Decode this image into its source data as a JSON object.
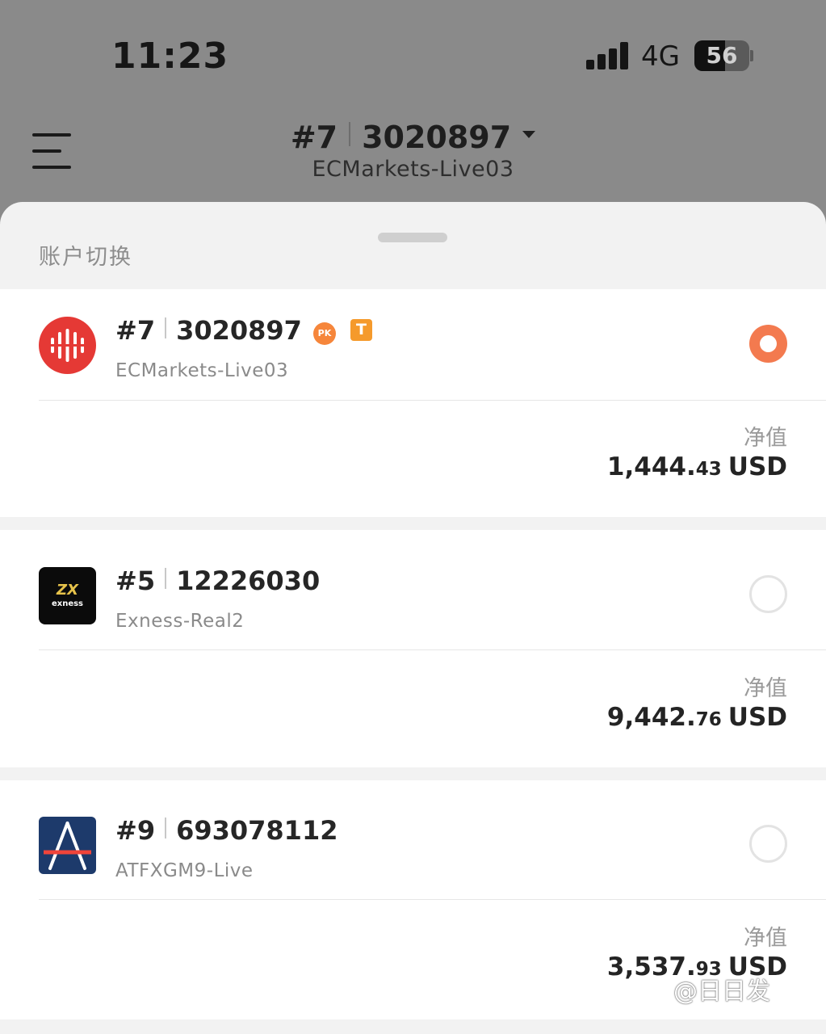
{
  "status_bar": {
    "time": "11:23",
    "network": "4G",
    "battery": "56"
  },
  "header": {
    "account_index": "#7",
    "account_number": "3020897",
    "server": "ECMarkets-Live03"
  },
  "sheet": {
    "title": "账户切换",
    "accounts": [
      {
        "index": "#7",
        "number": "3020897",
        "server": "ECMarkets-Live03",
        "selected": true,
        "badges": [
          "PK",
          "T"
        ],
        "equity_label": "净值",
        "equity_int": "1,444.",
        "equity_dec": "43",
        "currency": "USD",
        "logo": "ecmarkets-logo"
      },
      {
        "index": "#5",
        "number": "12226030",
        "server": "Exness-Real2",
        "selected": false,
        "equity_label": "净值",
        "equity_int": "9,442.",
        "equity_dec": "76",
        "currency": "USD",
        "logo": "exness-logo",
        "logo_text": [
          "ZX",
          "exness"
        ]
      },
      {
        "index": "#9",
        "number": "693078112",
        "server": "ATFXGM9-Live",
        "selected": false,
        "equity_label": "净值",
        "equity_int": "3,537.",
        "equity_dec": "93",
        "currency": "USD",
        "logo": "atfx-logo"
      }
    ]
  },
  "watermark": "@日日发",
  "colors": {
    "accent": "#f37a4f",
    "ecmarkets_red": "#e53935",
    "atfx_navy": "#1d3a6b"
  }
}
